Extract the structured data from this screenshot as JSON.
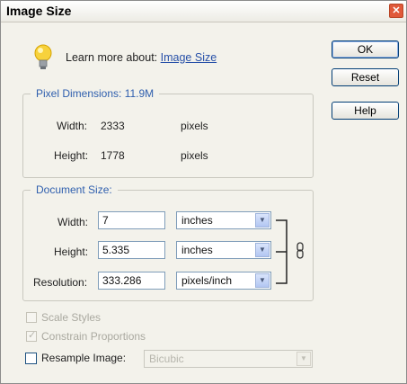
{
  "window": {
    "title": "Image Size",
    "close_glyph": "✕"
  },
  "learn": {
    "text": "Learn more about:",
    "link": "Image Size"
  },
  "buttons": {
    "ok": "OK",
    "reset": "Reset",
    "help": "Help"
  },
  "pixel_dimensions": {
    "legend": "Pixel Dimensions: 11.9M",
    "width_label": "Width:",
    "width_value": "2333",
    "width_unit": "pixels",
    "height_label": "Height:",
    "height_value": "1778",
    "height_unit": "pixels"
  },
  "document_size": {
    "legend": "Document Size:",
    "width_label": "Width:",
    "width_value": "7",
    "width_unit": "inches",
    "height_label": "Height:",
    "height_value": "5.335",
    "height_unit": "inches",
    "resolution_label": "Resolution:",
    "resolution_value": "333.286",
    "resolution_unit": "pixels/inch"
  },
  "options": {
    "scale_styles": {
      "label": "Scale Styles",
      "checked": false
    },
    "constrain_proportions": {
      "label": "Constrain Proportions",
      "checked": true
    },
    "resample": {
      "label": "Resample Image:",
      "value": "Bicubic",
      "checked": false
    }
  },
  "icons": {
    "tip": "lightbulb-icon",
    "link": "chain-link-icon",
    "dropdown": "chevron-down-icon"
  }
}
